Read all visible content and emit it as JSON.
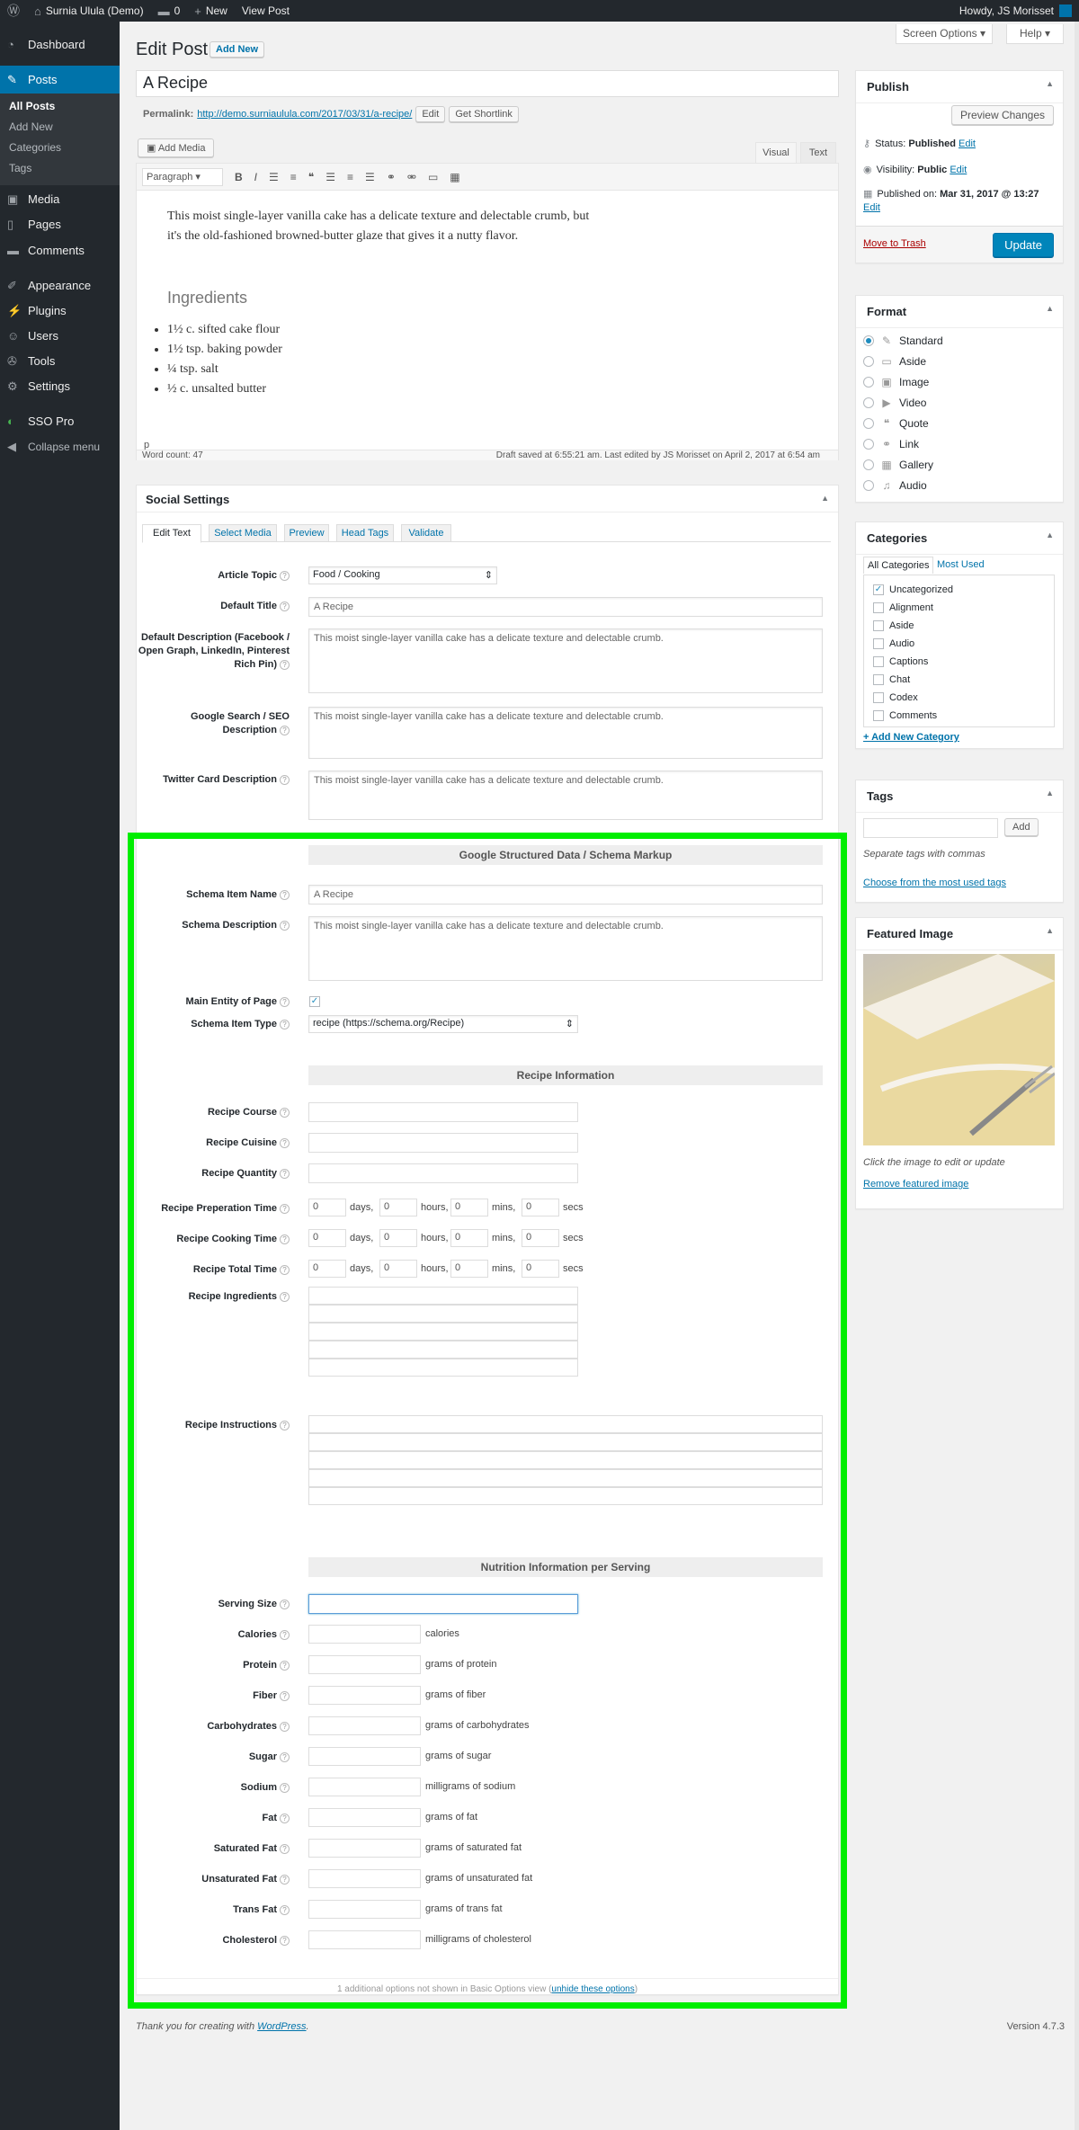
{
  "adminbar": {
    "site": "Surnia Ulula (Demo)",
    "comments": "0",
    "new": "New",
    "view": "View Post",
    "howdy": "Howdy, JS Morisset"
  },
  "menu": {
    "dashboard": "Dashboard",
    "posts": "Posts",
    "all_posts": "All Posts",
    "add_new": "Add New",
    "categories": "Categories",
    "tags": "Tags",
    "media": "Media",
    "pages": "Pages",
    "comments": "Comments",
    "appearance": "Appearance",
    "plugins": "Plugins",
    "users": "Users",
    "tools": "Tools",
    "settings": "Settings",
    "sso": "SSO Pro",
    "collapse": "Collapse menu"
  },
  "screen_options": "Screen Options ▾",
  "help": "Help ▾",
  "heading": "Edit Post",
  "add_new": "Add New",
  "post_title": "A Recipe",
  "permalink": {
    "label": "Permalink:",
    "url": "http://demo.surniaulula.com/2017/03/31/a-recipe/",
    "edit": "Edit",
    "shortlink": "Get Shortlink"
  },
  "editor": {
    "add_media": "Add Media",
    "visual": "Visual",
    "text": "Text",
    "format": "Paragraph",
    "para": "This moist single-layer vanilla cake has a delicate texture and delectable crumb, but it's the old-fashioned browned-butter glaze that gives it a nutty flavor.",
    "subheading": "Ingredients",
    "items": [
      "1½ c. sifted cake flour",
      "1½ tsp. baking powder",
      "¼ tsp. salt",
      "½ c. unsalted butter"
    ],
    "path": "p",
    "word_count": "Word count: 47",
    "draft_saved": "Draft saved at 6:55:21 am. Last edited by JS Morisset on April 2, 2017 at 6:54 am"
  },
  "social": {
    "title": "Social Settings",
    "tabs": [
      "Edit Text",
      "Select Media",
      "Preview",
      "Head Tags",
      "Validate"
    ],
    "topic_label": "Article Topic",
    "topic_value": "Food / Cooking",
    "default_title_label": "Default Title",
    "default_title": "A Recipe",
    "desc_label": "Default Description (Facebook / Open Graph, LinkedIn, Pinterest Rich Pin)",
    "desc": "This moist single-layer vanilla cake has a delicate texture and delectable crumb.",
    "seo_label": "Google Search / SEO Description",
    "seo": "This moist single-layer vanilla cake has a delicate texture and delectable crumb.",
    "twitter_label": "Twitter Card Description",
    "twitter": "This moist single-layer vanilla cake has a delicate texture and delectable crumb."
  },
  "schema": {
    "header": "Google Structured Data / Schema Markup",
    "name_label": "Schema Item Name",
    "name": "A Recipe",
    "desc_label": "Schema Description",
    "desc": "This moist single-layer vanilla cake has a delicate texture and delectable crumb.",
    "main_entity_label": "Main Entity of Page",
    "type_label": "Schema Item Type",
    "type_value": "recipe (https://schema.org/Recipe)"
  },
  "recipe": {
    "header": "Recipe Information",
    "course": "Recipe Course",
    "cuisine": "Recipe Cuisine",
    "quantity": "Recipe Quantity",
    "prep": "Recipe Preperation Time",
    "cook": "Recipe Cooking Time",
    "total": "Recipe Total Time",
    "zero": "0",
    "days": "days,",
    "hours": "hours,",
    "mins": "mins,",
    "secs": "secs",
    "ingredients": "Recipe Ingredients",
    "instructions": "Recipe Instructions"
  },
  "nutrition": {
    "header": "Nutrition Information per Serving",
    "serving": "Serving Size",
    "rows": [
      {
        "label": "Calories",
        "unit": "calories"
      },
      {
        "label": "Protein",
        "unit": "grams of protein"
      },
      {
        "label": "Fiber",
        "unit": "grams of fiber"
      },
      {
        "label": "Carbohydrates",
        "unit": "grams of carbohydrates"
      },
      {
        "label": "Sugar",
        "unit": "grams of sugar"
      },
      {
        "label": "Sodium",
        "unit": "milligrams of sodium"
      },
      {
        "label": "Fat",
        "unit": "grams of fat"
      },
      {
        "label": "Saturated Fat",
        "unit": "grams of saturated fat"
      },
      {
        "label": "Unsaturated Fat",
        "unit": "grams of unsaturated fat"
      },
      {
        "label": "Trans Fat",
        "unit": "grams of trans fat"
      },
      {
        "label": "Cholesterol",
        "unit": "milligrams of cholesterol"
      }
    ]
  },
  "options_note": {
    "pre": "1 additional options not shown in Basic Options view (",
    "link": "unhide these options",
    "post": ")"
  },
  "publish": {
    "title": "Publish",
    "preview": "Preview Changes",
    "status": "Status: ",
    "status_val": "Published",
    "visibility": "Visibility: ",
    "visibility_val": "Public",
    "published_on": "Published on: ",
    "date": "Mar 31, 2017 @ 13:27",
    "edit": "Edit",
    "trash": "Move to Trash",
    "update": "Update"
  },
  "format": {
    "title": "Format",
    "options": [
      "Standard",
      "Aside",
      "Image",
      "Video",
      "Quote",
      "Link",
      "Gallery",
      "Audio"
    ]
  },
  "categories": {
    "title": "Categories",
    "tab_all": "All Categories",
    "tab_most": "Most Used",
    "items": [
      "Uncategorized",
      "Alignment",
      "Aside",
      "Audio",
      "Captions",
      "Chat",
      "Codex",
      "Comments"
    ],
    "add": "+ Add New Category"
  },
  "tags": {
    "title": "Tags",
    "add": "Add",
    "hint": "Separate tags with commas",
    "choose": "Choose from the most used tags"
  },
  "featured": {
    "title": "Featured Image",
    "hint": "Click the image to edit or update",
    "remove": "Remove featured image"
  },
  "footer": {
    "thanks": "Thank you for creating with ",
    "wp": "WordPress",
    "dot": ".",
    "version": "Version 4.7.3"
  },
  "highlight_color": "#00ee00"
}
